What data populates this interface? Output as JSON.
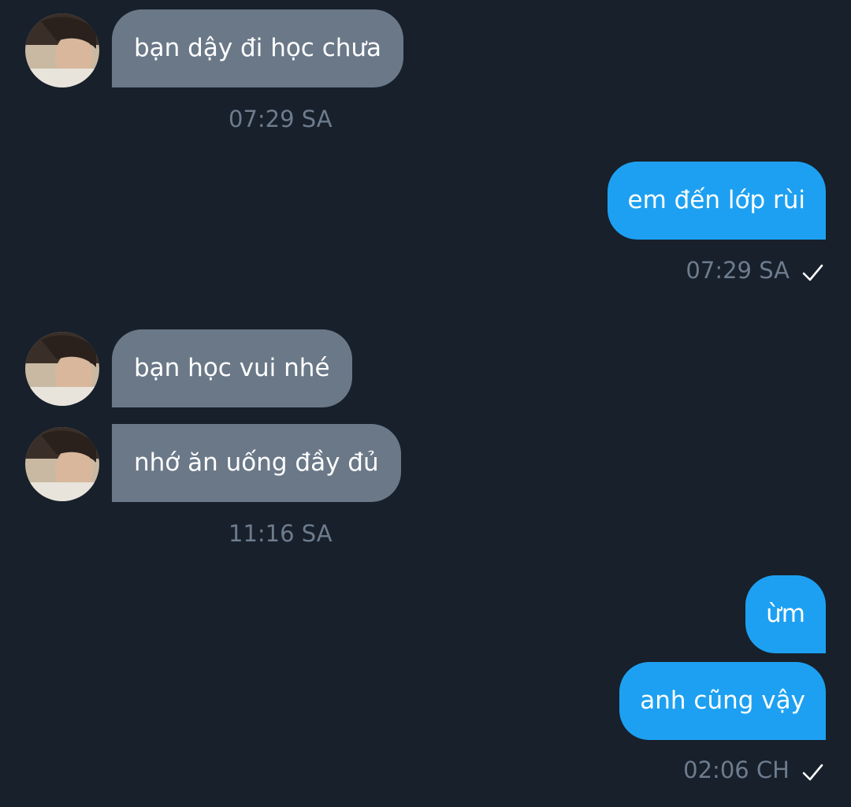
{
  "messages": [
    {
      "direction": "in",
      "text": "bạn dậy đi học chưa"
    },
    {
      "direction": "out",
      "text": "em đến lớp rùi"
    },
    {
      "direction": "in",
      "text": "bạn học vui nhé"
    },
    {
      "direction": "in",
      "text": "nhớ ăn uống đầy đủ"
    },
    {
      "direction": "out",
      "text": "ừm"
    },
    {
      "direction": "out",
      "text": "anh cũng vậy"
    }
  ],
  "timestamps": [
    {
      "text": "07:29 SA"
    },
    {
      "text": "07:29 SA",
      "status_icon": "check-icon"
    },
    {
      "text": "11:16 SA"
    },
    {
      "text": "02:06 CH",
      "status_icon": "check-icon"
    }
  ],
  "colors": {
    "background": "#17202b",
    "incoming_bubble": "#6a7888",
    "outgoing_bubble": "#1da0f1",
    "timestamp": "#6d7c8d",
    "text": "#ffffff"
  }
}
